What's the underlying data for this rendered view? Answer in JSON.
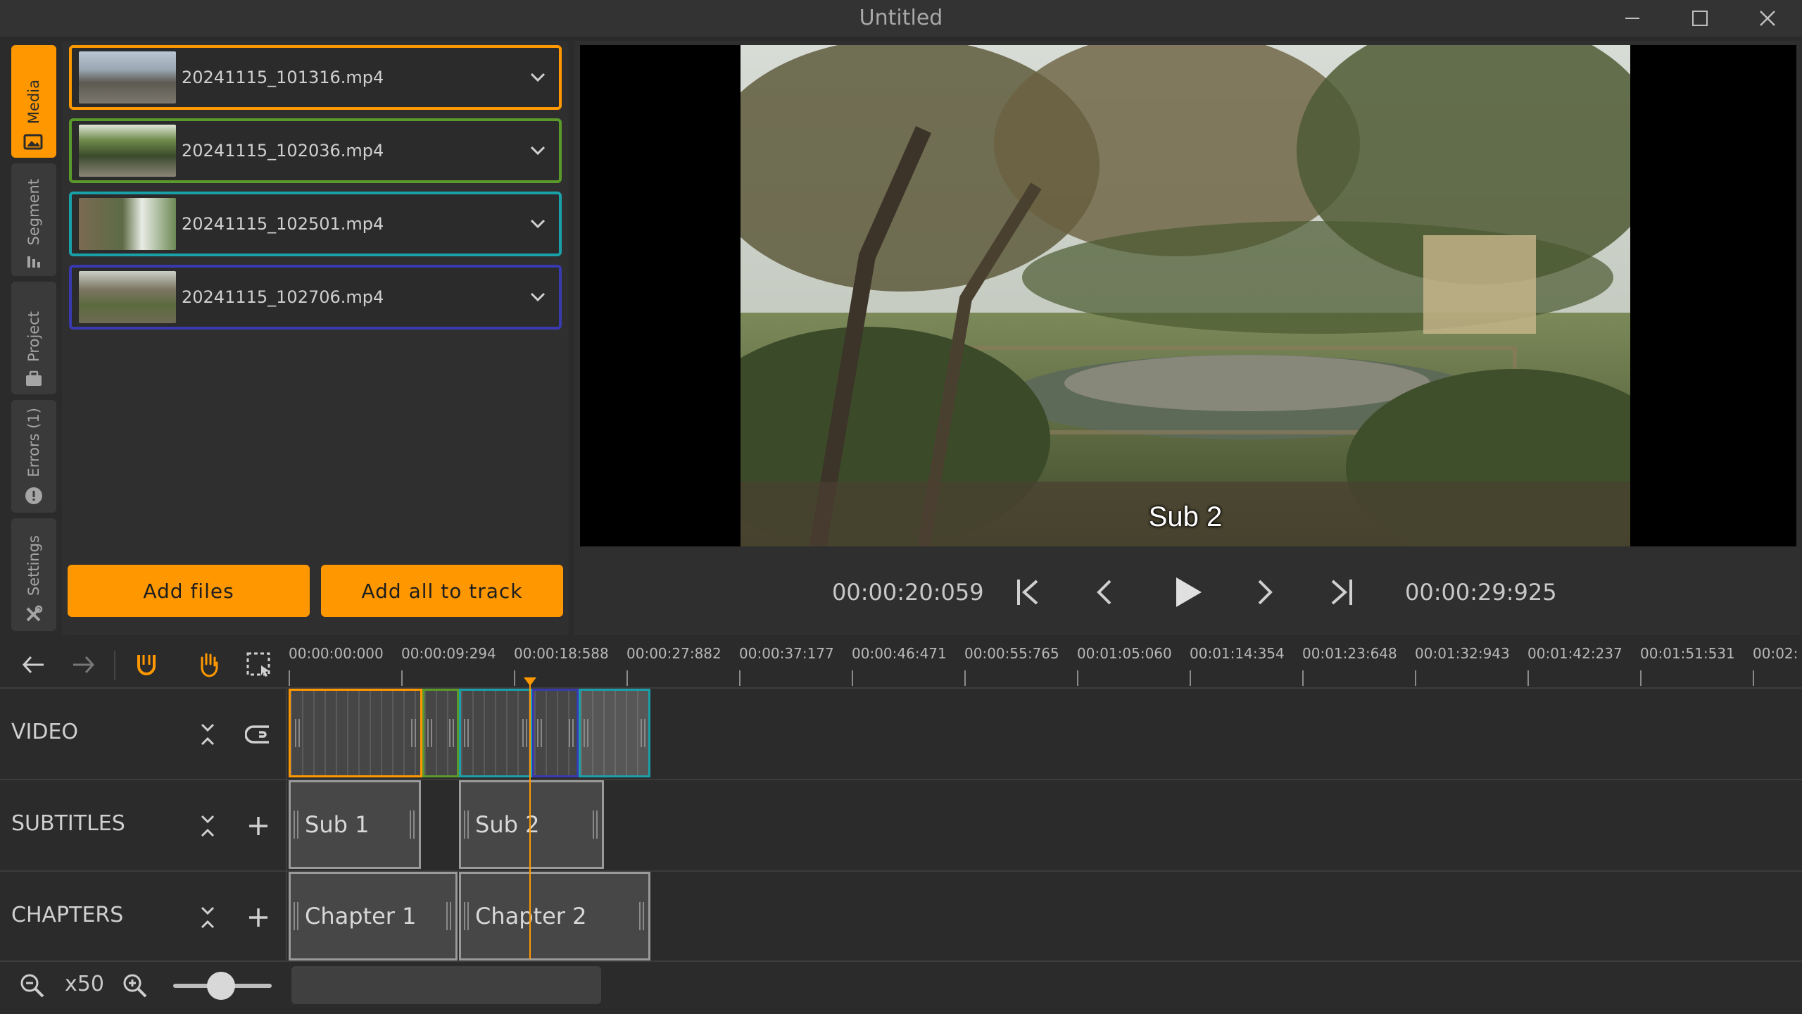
{
  "window": {
    "title": "Untitled"
  },
  "side_tabs": [
    {
      "label": "Media",
      "icon": "image-icon",
      "active": true
    },
    {
      "label": "Segment",
      "icon": "segment-icon",
      "active": false
    },
    {
      "label": "Project",
      "icon": "briefcase-icon",
      "active": false
    },
    {
      "label": "Errors (1)",
      "icon": "alert-icon",
      "active": false
    },
    {
      "label": "Settings",
      "icon": "tools-icon",
      "active": false
    }
  ],
  "media": {
    "items": [
      {
        "name": "20241115_101316.mp4",
        "color": "#ff9800"
      },
      {
        "name": "20241115_102036.mp4",
        "color": "#5a9a2a"
      },
      {
        "name": "20241115_102501.mp4",
        "color": "#1aa0a8"
      },
      {
        "name": "20241115_102706.mp4",
        "color": "#3a3ab0"
      }
    ],
    "add_files_label": "Add files",
    "add_all_label": "Add all to track"
  },
  "player": {
    "current_time": "00:00:20:059",
    "total_time": "00:00:29:925",
    "subtitle_text": "Sub 2"
  },
  "timeline": {
    "ruler_labels": [
      "00:00:00:000",
      "00:00:09:294",
      "00:00:18:588",
      "00:00:27:882",
      "00:00:37:177",
      "00:00:46:471",
      "00:00:55:765",
      "00:01:05:060",
      "00:01:14:354",
      "00:01:23:648",
      "00:01:32:943",
      "00:01:42:237",
      "00:01:51:531",
      "00:02:"
    ],
    "tracks": {
      "video": {
        "label": "VIDEO"
      },
      "subtitles": {
        "label": "SUBTITLES",
        "clips": [
          "Sub 1",
          "Sub 2"
        ]
      },
      "chapters": {
        "label": "CHAPTERS",
        "clips": [
          "Chapter 1",
          "Chapter 2"
        ]
      }
    },
    "zoom_label": "x50"
  },
  "colors": {
    "accent": "#ff9800",
    "panel": "#2f2f2f",
    "background": "#2b2b2b"
  }
}
